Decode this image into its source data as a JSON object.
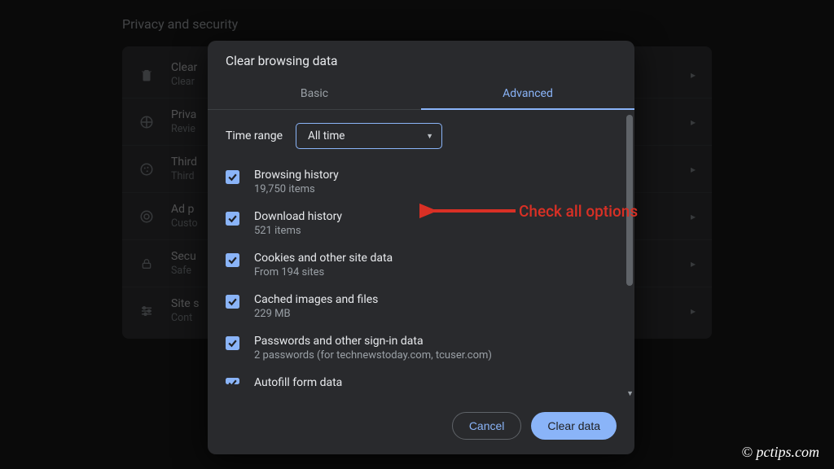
{
  "bg": {
    "section_title": "Privacy and security",
    "rows": [
      {
        "icon": "trash",
        "title": "Clear",
        "sub": "Clear"
      },
      {
        "icon": "shield",
        "title": "Priva",
        "sub": "Revie"
      },
      {
        "icon": "cookie",
        "title": "Third",
        "sub": "Third"
      },
      {
        "icon": "ads",
        "title": "Ad p",
        "sub": "Custo"
      },
      {
        "icon": "lock",
        "title": "Secu",
        "sub": "Safe"
      },
      {
        "icon": "sliders",
        "title": "Site s",
        "sub": "Cont"
      }
    ]
  },
  "modal": {
    "title": "Clear browsing data",
    "tabs": {
      "basic": "Basic",
      "advanced": "Advanced"
    },
    "time_label": "Time range",
    "time_value": "All time",
    "items": [
      {
        "title": "Browsing history",
        "sub": "19,750 items"
      },
      {
        "title": "Download history",
        "sub": "521 items"
      },
      {
        "title": "Cookies and other site data",
        "sub": "From 194 sites"
      },
      {
        "title": "Cached images and files",
        "sub": "229 MB"
      },
      {
        "title": "Passwords and other sign-in data",
        "sub": "2 passwords (for technewstoday.com, tcuser.com)"
      },
      {
        "title": "Autofill form data",
        "sub": ""
      }
    ],
    "cancel": "Cancel",
    "confirm": "Clear data"
  },
  "annotation": "Check all options",
  "watermark": "© pctips.com"
}
